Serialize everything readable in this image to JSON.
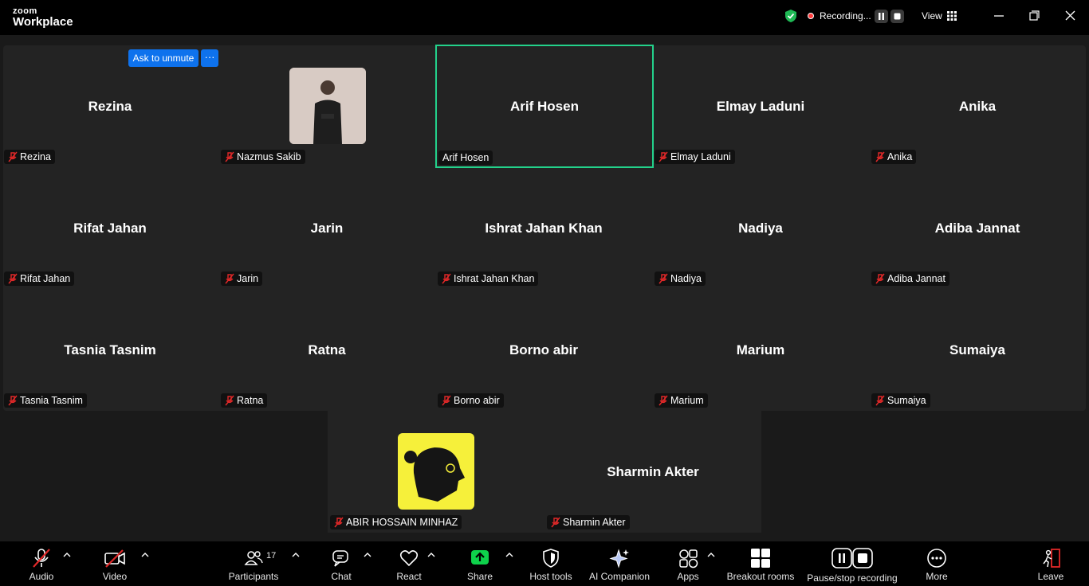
{
  "app": {
    "brand_small": "zoom",
    "brand_large": "Workplace"
  },
  "topbar": {
    "recording_label": "Recording...",
    "view_label": "View"
  },
  "controls": {
    "ask_to_unmute": "Ask to unmute",
    "more_dots": "···"
  },
  "participants": [
    {
      "big": "Rezina",
      "label": "Rezina"
    },
    {
      "big": "",
      "label": "Nazmus Sakib"
    },
    {
      "big": "Arif Hosen",
      "label": "Arif Hosen"
    },
    {
      "big": "Elmay Laduni",
      "label": "Elmay Laduni"
    },
    {
      "big": "Anika",
      "label": "Anika"
    },
    {
      "big": "Rifat Jahan",
      "label": "Rifat Jahan"
    },
    {
      "big": "Jarin",
      "label": "Jarin"
    },
    {
      "big": "Ishrat Jahan Khan",
      "label": "Ishrat Jahan Khan"
    },
    {
      "big": "Nadiya",
      "label": "Nadiya"
    },
    {
      "big": "Adiba Jannat",
      "label": "Adiba Jannat"
    },
    {
      "big": "Tasnia Tasnim",
      "label": "Tasnia Tasnim"
    },
    {
      "big": "Ratna",
      "label": "Ratna"
    },
    {
      "big": "Borno abir",
      "label": "Borno abir"
    },
    {
      "big": "Marium",
      "label": "Marium"
    },
    {
      "big": "Sumaiya",
      "label": "Sumaiya"
    },
    {
      "big": "",
      "label": "ABIR HOSSAIN MINHAZ"
    },
    {
      "big": "Sharmin Akter",
      "label": "Sharmin Akter"
    }
  ],
  "toolbar": {
    "audio": "Audio",
    "video": "Video",
    "participants": "Participants",
    "participants_count": "17",
    "chat": "Chat",
    "react": "React",
    "share": "Share",
    "host_tools": "Host tools",
    "ai_companion": "AI Companion",
    "apps": "Apps",
    "breakout_rooms": "Breakout rooms",
    "pause_stop_recording": "Pause/stop recording",
    "more": "More",
    "leave": "Leave"
  },
  "colors": {
    "active_speaker": "#23d18b",
    "accent_blue": "#0e72ed",
    "share_green": "#0ed14b",
    "muted_red": "#e02828"
  }
}
